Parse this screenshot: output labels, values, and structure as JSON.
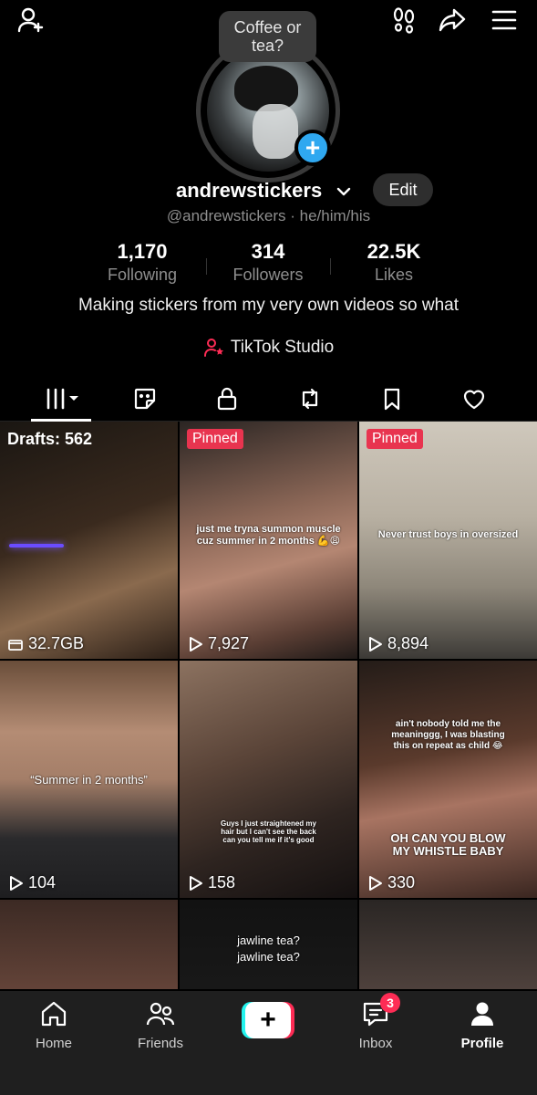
{
  "top_bar": {
    "icons": [
      "add-friend-icon",
      "footprint-icon",
      "share-icon",
      "menu-icon"
    ]
  },
  "bubble": {
    "text": "Coffee or tea?"
  },
  "profile": {
    "username": "andrewstickers",
    "edit_label": "Edit",
    "handle": "@andrewstickers · he/him/his",
    "bio": "Making stickers from my very own videos so what",
    "studio_label": "TikTok Studio"
  },
  "stats": [
    {
      "value": "1,170",
      "label": "Following"
    },
    {
      "value": "314",
      "label": "Followers"
    },
    {
      "value": "22.5K",
      "label": "Likes"
    }
  ],
  "tabs": [
    "videos-grid-icon",
    "sticker-icon",
    "lock-icon",
    "repost-icon",
    "bookmark-icon",
    "heart-icon"
  ],
  "grid": [
    {
      "drafts": "Drafts: 562",
      "views": "32.7GB",
      "overlay": "",
      "bg": "linear-gradient(160deg,#1a1612 0%,#3a2a1e 45%,#8a6a4e 70%,#2a1e16 100%)"
    },
    {
      "badge": "Pinned",
      "views": "7,927",
      "overlay": "just me tryna summon muscle cuz summer in 2 months 💪😩",
      "bg": "linear-gradient(165deg,#2b2523 0%,#8a6656 40%,#b48672 60%,#5a3e34 85%,#201a18 100%)"
    },
    {
      "badge": "Pinned",
      "views": "8,894",
      "overlay": "Never trust boys in oversized",
      "bg": "linear-gradient(180deg,#cfc8bc 0%,#b8b0a2 40%,#8e877a 70%,#3c3a36 100%)"
    },
    {
      "views": "104",
      "overlay": "“Summer in 2 months”",
      "bg": "linear-gradient(180deg,#6a4e3a 0%,#b48c74 30%,#a47e68 50%,#2a2a2c 75%,#1e1e20 100%)"
    },
    {
      "views": "158",
      "overlay": "Guys I just straightened my hair but I can't see the back can you tell me if it's good",
      "bg": "linear-gradient(160deg,#8c7260 0%,#5a4438 40%,#2e2420 70%,#141010 100%)"
    },
    {
      "views": "330",
      "overlay": "ain't nobody told me the meaninggg, I was blasting this on repeat as child 😂",
      "overlay2": "OH CAN YOU BLOW MY WHISTLE BABY",
      "bg": "linear-gradient(170deg,#241c18 0%,#5a3a2c 40%,#a87462 60%,#3a2620 100%)"
    },
    {
      "bg": "linear-gradient(180deg,#3c2a24 0%,#7a5244 60%,#2a1e1a 100%)"
    },
    {
      "overlay": "jawline tea?",
      "overlay_b": "jawline tea?",
      "bg": "linear-gradient(180deg,#121212 0%,#1c1c1c 60%,#2c2420 100%)"
    },
    {
      "bg": "linear-gradient(180deg,#2a2624 0%,#5a4a44 50%,#3a302c 100%)"
    }
  ],
  "nav": {
    "items": [
      {
        "label": "Home",
        "icon": "home-icon"
      },
      {
        "label": "Friends",
        "icon": "friends-icon"
      },
      {
        "label": "",
        "icon": "create-icon"
      },
      {
        "label": "Inbox",
        "icon": "inbox-icon",
        "badge": "3"
      },
      {
        "label": "Profile",
        "icon": "profile-icon"
      }
    ]
  }
}
